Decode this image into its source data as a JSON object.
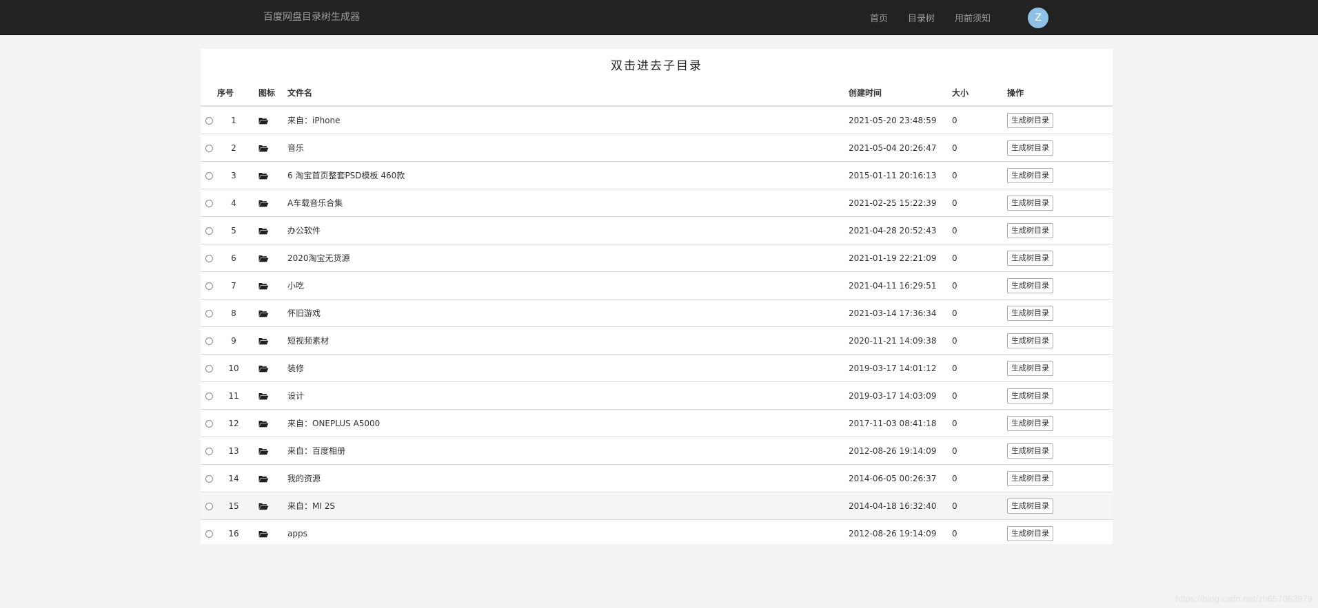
{
  "navbar": {
    "brand": "百度网盘目录树生成器",
    "links": [
      "首页",
      "目录树",
      "用前须知"
    ],
    "avatar_letter": "Z"
  },
  "panel": {
    "title": "双击进去子目录"
  },
  "table": {
    "headers": {
      "index": "序号",
      "icon": "图标",
      "name": "文件名",
      "created": "创建时间",
      "size": "大小",
      "action": "操作"
    },
    "button_label": "生成树目录",
    "rows": [
      {
        "index": "1",
        "name": "来自：iPhone",
        "created": "2021-05-20 23:48:59",
        "size": "0"
      },
      {
        "index": "2",
        "name": "音乐",
        "created": "2021-05-04 20:26:47",
        "size": "0"
      },
      {
        "index": "3",
        "name": "6 淘宝首页整套PSD模板 460款",
        "created": "2015-01-11 20:16:13",
        "size": "0"
      },
      {
        "index": "4",
        "name": "A车载音乐合集",
        "created": "2021-02-25 15:22:39",
        "size": "0"
      },
      {
        "index": "5",
        "name": "办公软件",
        "created": "2021-04-28 20:52:43",
        "size": "0"
      },
      {
        "index": "6",
        "name": "2020淘宝无货源",
        "created": "2021-01-19 22:21:09",
        "size": "0"
      },
      {
        "index": "7",
        "name": "小吃",
        "created": "2021-04-11 16:29:51",
        "size": "0"
      },
      {
        "index": "8",
        "name": "怀旧游戏",
        "created": "2021-03-14 17:36:34",
        "size": "0"
      },
      {
        "index": "9",
        "name": "短视频素材",
        "created": "2020-11-21 14:09:38",
        "size": "0"
      },
      {
        "index": "10",
        "name": "装修",
        "created": "2019-03-17 14:01:12",
        "size": "0"
      },
      {
        "index": "11",
        "name": "设计",
        "created": "2019-03-17 14:03:09",
        "size": "0"
      },
      {
        "index": "12",
        "name": "来自：ONEPLUS A5000",
        "created": "2017-11-03 08:41:18",
        "size": "0"
      },
      {
        "index": "13",
        "name": "来自：百度相册",
        "created": "2012-08-26 19:14:09",
        "size": "0"
      },
      {
        "index": "14",
        "name": "我的资源",
        "created": "2014-06-05 00:26:37",
        "size": "0"
      },
      {
        "index": "15",
        "name": "来自：MI 2S",
        "created": "2014-04-18 16:32:40",
        "size": "0"
      },
      {
        "index": "16",
        "name": "apps",
        "created": "2012-08-26 19:14:09",
        "size": "0"
      }
    ]
  },
  "icons": {
    "row_icon": "folder-open-icon"
  },
  "colors": {
    "navbar_bg": "#222222",
    "nav_text": "#9d9d9d",
    "avatar_bg": "#8fc0e6",
    "page_bg": "#f3f3f3"
  },
  "watermark": "https://blog.csdn.net/zh657083979"
}
